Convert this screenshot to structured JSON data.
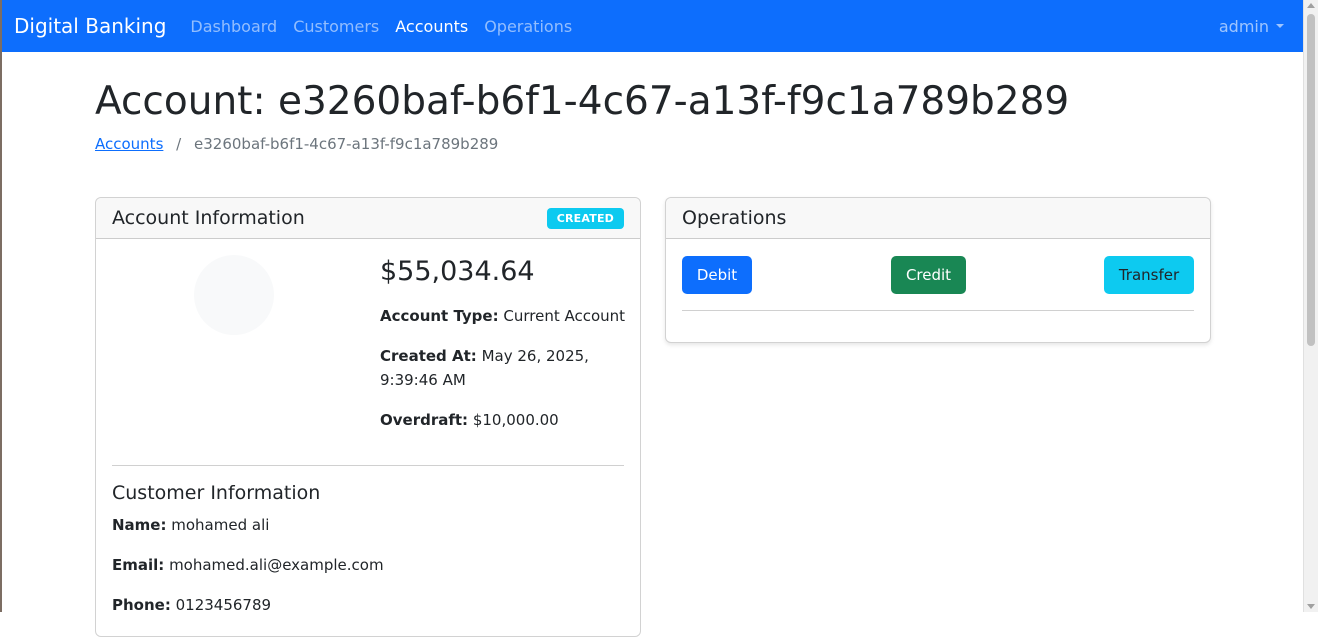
{
  "navbar": {
    "brand": "Digital Banking",
    "links": [
      "Dashboard",
      "Customers",
      "Accounts",
      "Operations"
    ],
    "active_link": "Accounts",
    "user": "admin"
  },
  "page": {
    "title": "Account: e3260baf-b6f1-4c67-a13f-f9c1a789b289",
    "breadcrumb": {
      "parent": "Accounts",
      "separator": "/",
      "current": "e3260baf-b6f1-4c67-a13f-f9c1a789b289"
    }
  },
  "account_info": {
    "header": "Account Information",
    "status": "CREATED",
    "balance": "$55,034.64",
    "account_type_label": "Account Type:",
    "account_type": "Current Account",
    "created_at_label": "Created At:",
    "created_at": "May 26, 2025, 9:39:46 AM",
    "overdraft_label": "Overdraft:",
    "overdraft": "$10,000.00"
  },
  "customer_info": {
    "heading": "Customer Information",
    "name_label": "Name:",
    "name": "mohamed ali",
    "email_label": "Email:",
    "email": "mohamed.ali@example.com",
    "phone_label": "Phone:",
    "phone": "0123456789"
  },
  "operations": {
    "header": "Operations",
    "debit_label": "Debit",
    "credit_label": "Credit",
    "transfer_label": "Transfer"
  },
  "colors": {
    "primary": "#0d6efd",
    "success": "#198754",
    "info": "#0dcaf0"
  }
}
